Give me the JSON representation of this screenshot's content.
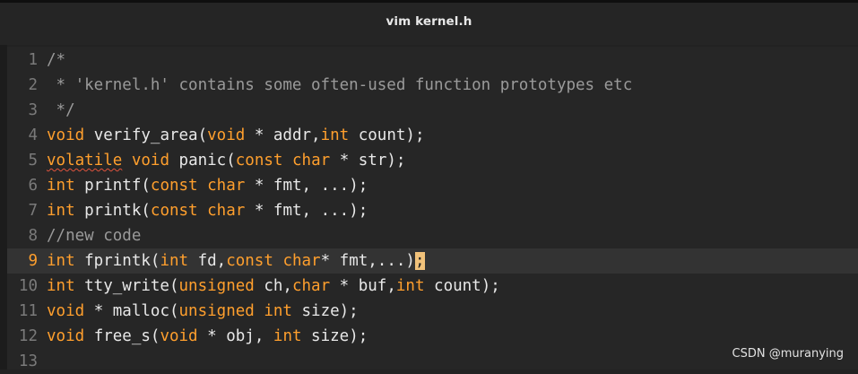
{
  "window": {
    "title": "vim kernel.h"
  },
  "colors": {
    "background": "#262626",
    "keyword": "#ff9f2d",
    "comment": "#9a9a9a",
    "text": "#e8e8e8",
    "line_number": "#7a7a7a",
    "current_line_number": "#ff9f2d"
  },
  "editor": {
    "current_line": 9,
    "lines": [
      {
        "num": "1",
        "tokens": [
          [
            "cm",
            "/*"
          ]
        ]
      },
      {
        "num": "2",
        "tokens": [
          [
            "cm",
            " * 'kernel.h' contains some often-used function prototypes etc"
          ]
        ]
      },
      {
        "num": "3",
        "tokens": [
          [
            "cm",
            " */"
          ]
        ]
      },
      {
        "num": "4",
        "tokens": [
          [
            "kw",
            "void"
          ],
          [
            "tx",
            " verify_area("
          ],
          [
            "kw",
            "void"
          ],
          [
            "tx",
            " * addr,"
          ],
          [
            "kw",
            "int"
          ],
          [
            "tx",
            " count);"
          ]
        ]
      },
      {
        "num": "5",
        "tokens": [
          [
            "kwsq",
            "volatile"
          ],
          [
            "tx",
            " "
          ],
          [
            "kw",
            "void"
          ],
          [
            "tx",
            " panic("
          ],
          [
            "kw",
            "const"
          ],
          [
            "tx",
            " "
          ],
          [
            "kw",
            "char"
          ],
          [
            "tx",
            " * str);"
          ]
        ]
      },
      {
        "num": "6",
        "tokens": [
          [
            "kw",
            "int"
          ],
          [
            "tx",
            " printf("
          ],
          [
            "kw",
            "const"
          ],
          [
            "tx",
            " "
          ],
          [
            "kw",
            "char"
          ],
          [
            "tx",
            " * fmt, ...);"
          ]
        ]
      },
      {
        "num": "7",
        "tokens": [
          [
            "kw",
            "int"
          ],
          [
            "tx",
            " printk("
          ],
          [
            "kw",
            "const"
          ],
          [
            "tx",
            " "
          ],
          [
            "kw",
            "char"
          ],
          [
            "tx",
            " * fmt, ...);"
          ]
        ]
      },
      {
        "num": "8",
        "tokens": [
          [
            "cm",
            "//new code"
          ]
        ]
      },
      {
        "num": "9",
        "tokens": [
          [
            "kw",
            "int"
          ],
          [
            "tx",
            " fprintk("
          ],
          [
            "kw",
            "int"
          ],
          [
            "tx",
            " fd,"
          ],
          [
            "kw",
            "const"
          ],
          [
            "tx",
            " "
          ],
          [
            "kw",
            "char"
          ],
          [
            "tx",
            "* fmt,...)"
          ],
          [
            "cursor",
            ";"
          ]
        ]
      },
      {
        "num": "10",
        "tokens": [
          [
            "kw",
            "int"
          ],
          [
            "tx",
            " tty_write("
          ],
          [
            "kw",
            "unsigned"
          ],
          [
            "tx",
            " ch,"
          ],
          [
            "kw",
            "char"
          ],
          [
            "tx",
            " * buf,"
          ],
          [
            "kw",
            "int"
          ],
          [
            "tx",
            " count);"
          ]
        ]
      },
      {
        "num": "11",
        "tokens": [
          [
            "kw",
            "void"
          ],
          [
            "tx",
            " * malloc("
          ],
          [
            "kw",
            "unsigned"
          ],
          [
            "tx",
            " "
          ],
          [
            "kw",
            "int"
          ],
          [
            "tx",
            " size);"
          ]
        ]
      },
      {
        "num": "12",
        "tokens": [
          [
            "kw",
            "void"
          ],
          [
            "tx",
            " free_s("
          ],
          [
            "kw",
            "void"
          ],
          [
            "tx",
            " * obj, "
          ],
          [
            "kw",
            "int"
          ],
          [
            "tx",
            " size);"
          ]
        ]
      },
      {
        "num": "13",
        "tokens": []
      }
    ]
  },
  "watermark": "CSDN @muranying"
}
